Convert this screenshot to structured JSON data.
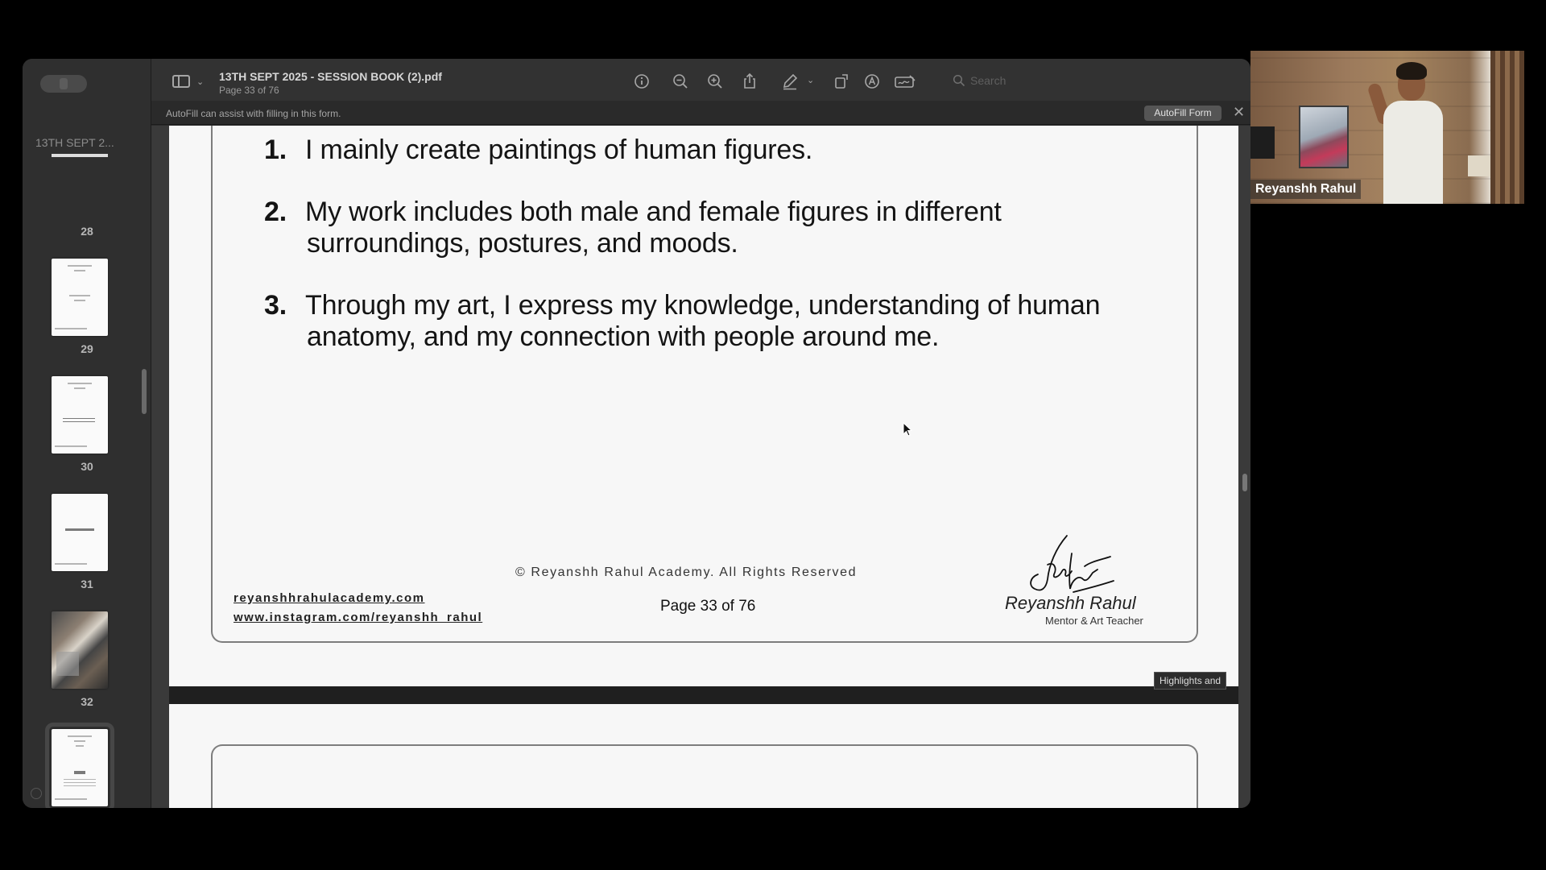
{
  "viewer": {
    "file_name": "13TH SEPT 2025 - SESSION BOOK (2).pdf",
    "page_indicator": "Page 33 of 76",
    "sidebar_title": "13TH SEPT 2...",
    "search_placeholder": "Search",
    "autofill_message": "AutoFill can assist with filling in this form.",
    "autofill_button": "AutoFill Form",
    "close_glyph": "✕",
    "tooltip": "Highlights and",
    "icons": [
      "sidebar-toggle-icon",
      "info-icon",
      "zoom-out-icon",
      "zoom-in-icon",
      "share-icon",
      "markup-pen-icon",
      "rotate-icon",
      "annotate-icon",
      "signature-icon",
      "search-icon"
    ]
  },
  "thumbnails": [
    {
      "number": "28",
      "kind": "partial"
    },
    {
      "number": "29",
      "kind": "text"
    },
    {
      "number": "30",
      "kind": "text"
    },
    {
      "number": "31",
      "kind": "title"
    },
    {
      "number": "32",
      "kind": "photo"
    },
    {
      "number": "33",
      "kind": "text",
      "selected": true
    }
  ],
  "page": {
    "items": [
      {
        "number": "1.",
        "lines": [
          "I mainly create paintings of human figures."
        ]
      },
      {
        "number": "2.",
        "lines": [
          "My work includes both male and female figures in different",
          "surroundings, postures, and moods."
        ]
      },
      {
        "number": "3.",
        "lines": [
          "Through my art, I express my knowledge, understanding of human",
          "anatomy, and my connection with people around me."
        ]
      }
    ],
    "copyright": "© Reyanshh Rahul Academy. All Rights Reserved",
    "links": [
      "reyanshhrahulacademy.com",
      "www.instagram.com/reyanshh_rahul"
    ],
    "page_label": "Page 33 of 76",
    "signature_name": "Reyanshh Rahul",
    "signature_role": "Mentor & Art Teacher"
  },
  "video": {
    "participant_name": "Reyanshh Rahul"
  }
}
